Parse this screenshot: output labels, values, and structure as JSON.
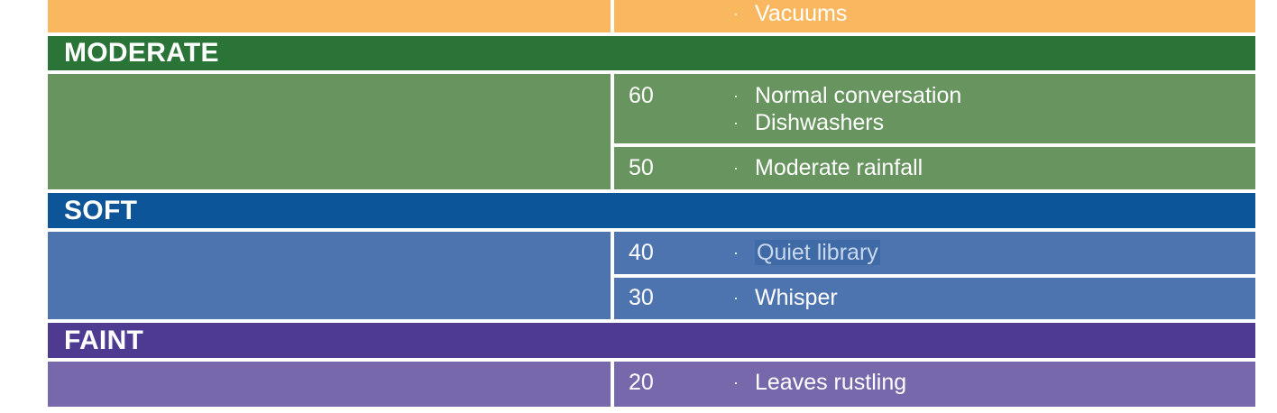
{
  "colors": {
    "loud_row": "#f9b85f",
    "moderate_header": "#2b7438",
    "moderate_row": "#67945f",
    "soft_header": "#0d5599",
    "soft_row": "#4e74b0",
    "faint_header": "#4e3b91",
    "faint_row": "#7768ab",
    "border": "#ffffff"
  },
  "top_row": {
    "examples": [
      "Vacuums"
    ]
  },
  "categories": [
    {
      "name": "MODERATE",
      "rows": [
        {
          "db": "60",
          "examples": [
            "Normal conversation",
            "Dishwashers"
          ]
        },
        {
          "db": "50",
          "examples": [
            "Moderate rainfall"
          ]
        }
      ]
    },
    {
      "name": "SOFT",
      "rows": [
        {
          "db": "40",
          "examples": [
            "Quiet library"
          ]
        },
        {
          "db": "30",
          "examples": [
            "Whisper"
          ]
        }
      ]
    },
    {
      "name": "FAINT",
      "rows": [
        {
          "db": "20",
          "examples": [
            "Leaves rustling"
          ]
        }
      ]
    }
  ],
  "bullet_char": "·"
}
